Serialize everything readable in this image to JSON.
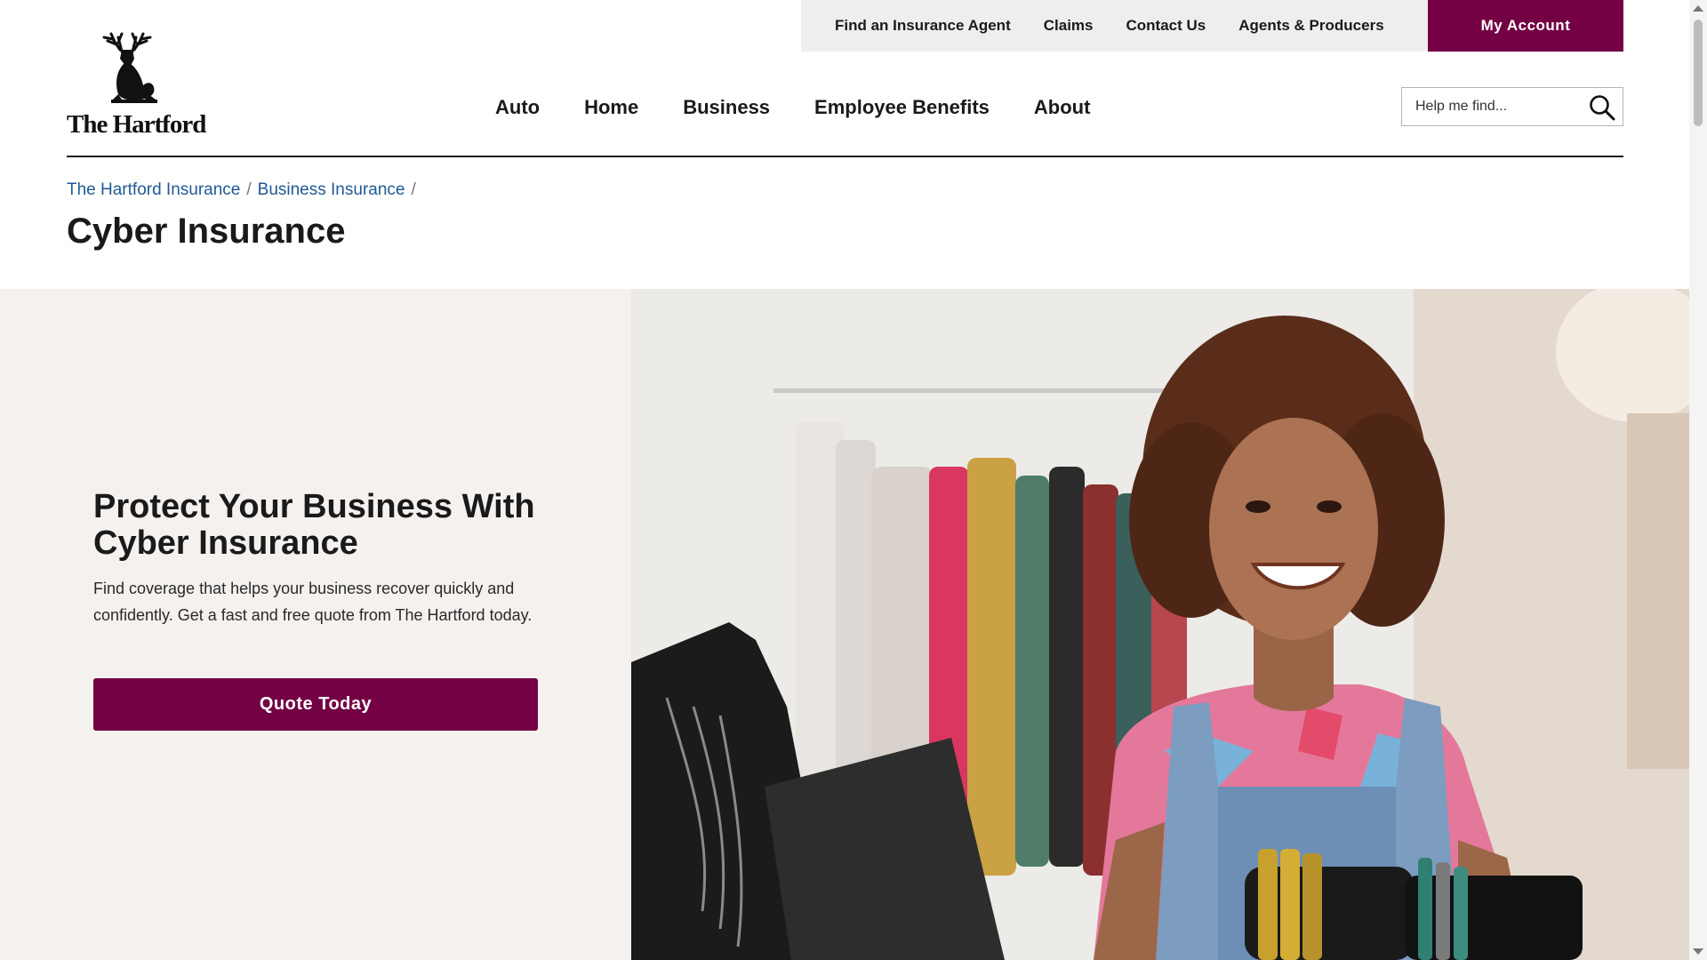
{
  "brand": {
    "name": "The Hartford"
  },
  "utility_nav": {
    "items": [
      {
        "label": "Find an Insurance Agent"
      },
      {
        "label": "Claims"
      },
      {
        "label": "Contact Us"
      },
      {
        "label": "Agents & Producers"
      }
    ],
    "account_label": "My Account"
  },
  "main_nav": {
    "items": [
      {
        "label": "Auto"
      },
      {
        "label": "Home"
      },
      {
        "label": "Business"
      },
      {
        "label": "Employee Benefits"
      },
      {
        "label": "About"
      }
    ]
  },
  "search": {
    "placeholder": "Help me find...",
    "icon": "search-icon"
  },
  "breadcrumb": {
    "items": [
      {
        "label": "The Hartford Insurance"
      },
      {
        "label": "Business Insurance"
      }
    ],
    "separator": "/"
  },
  "page": {
    "title": "Cyber Insurance"
  },
  "hero": {
    "heading": "Protect Your Business With Cyber Insurance",
    "body": "Find coverage that helps your business recover quickly and confidently. Get a fast and free quote from The Hartford today.",
    "cta_label": "Quote Today",
    "image_subject": "smiling woman at a boutique counter with laptop, clothing rack and jewelry display"
  },
  "colors": {
    "brand": "#740144",
    "link": "#1f5a93",
    "hero_panel": "#f4f1ef",
    "utility_bar": "#efeeee",
    "text": "#1a1a1a"
  }
}
